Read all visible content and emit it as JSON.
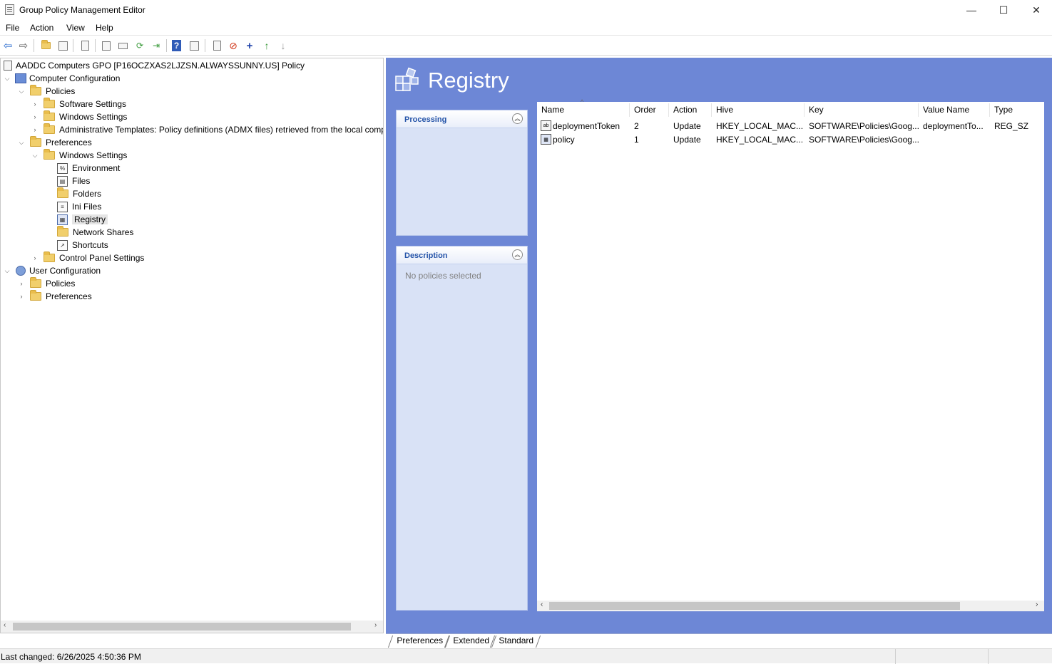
{
  "window": {
    "title": "Group Policy Management Editor",
    "minimize": "—",
    "maximize": "☐",
    "close": "✕"
  },
  "menu": [
    "File",
    "Action",
    "View",
    "Help"
  ],
  "tree": {
    "root": "AADDC Computers GPO [P16OCZXAS2LJZSN.ALWAYSSUNNY.US] Policy",
    "computer_configuration": "Computer Configuration",
    "policies": "Policies",
    "software_settings": "Software Settings",
    "windows_settings": "Windows Settings",
    "admin_templates": "Administrative Templates: Policy definitions (ADMX files) retrieved from the local comp",
    "preferences": "Preferences",
    "pref_windows_settings": "Windows Settings",
    "environment": "Environment",
    "files": "Files",
    "folders": "Folders",
    "ini_files": "Ini Files",
    "registry": "Registry",
    "network_shares": "Network Shares",
    "shortcuts": "Shortcuts",
    "control_panel_settings": "Control Panel Settings",
    "user_configuration": "User Configuration",
    "user_policies": "Policies",
    "user_preferences": "Preferences"
  },
  "right_pane": {
    "title": "Registry",
    "processing_label": "Processing",
    "description_label": "Description",
    "description_text": "No policies selected"
  },
  "table": {
    "columns": [
      "Name",
      "Order",
      "Action",
      "Hive",
      "Key",
      "Value Name",
      "Type"
    ],
    "rows": [
      {
        "name": "deploymentToken",
        "order": "2",
        "action": "Update",
        "hive": "HKEY_LOCAL_MAC...",
        "key": "SOFTWARE\\Policies\\Goog...",
        "value_name": "deploymentTo...",
        "type": "REG_SZ"
      },
      {
        "name": "policy",
        "order": "1",
        "action": "Update",
        "hive": "HKEY_LOCAL_MAC...",
        "key": "SOFTWARE\\Policies\\Goog...",
        "value_name": "",
        "type": ""
      }
    ]
  },
  "tabs": [
    "Preferences",
    "Extended",
    "Standard"
  ],
  "status": {
    "text": "Last changed: 6/26/2025 4:50:36 PM"
  },
  "colors": {
    "pane_background": "#6d87d6",
    "panel_background": "#d9e2f6",
    "panel_label": "#2453a8"
  }
}
